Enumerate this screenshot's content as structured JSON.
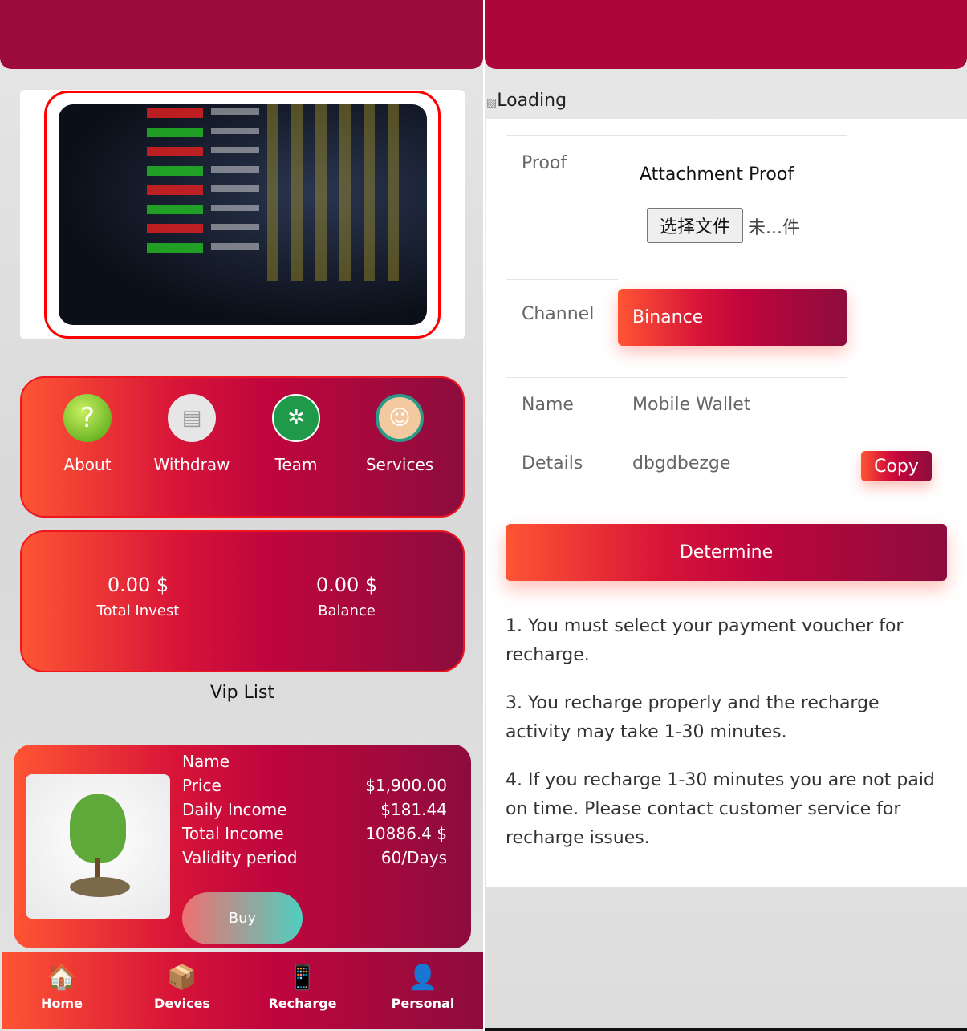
{
  "home": {
    "menu": [
      {
        "label": "About",
        "icon": "question-icon"
      },
      {
        "label": "Withdraw",
        "icon": "atm-icon"
      },
      {
        "label": "Team",
        "icon": "teamwork-icon"
      },
      {
        "label": "Services",
        "icon": "headset-agent-icon"
      }
    ],
    "stats": [
      {
        "value": "0.00 $",
        "label": "Total Invest"
      },
      {
        "value": "0.00 $",
        "label": "Balance"
      }
    ],
    "vip_title": "Vip List",
    "product": {
      "rows": [
        {
          "label": "Name",
          "value": ""
        },
        {
          "label": "Price",
          "value": "$1,900.00"
        },
        {
          "label": "Daily Income",
          "value": "$181.44"
        },
        {
          "label": "Total Income",
          "value": "10886.4 $"
        },
        {
          "label": "Validity period",
          "value": "60/Days"
        }
      ],
      "buy_label": "Buy"
    },
    "nav": [
      {
        "label": "Home",
        "icon": "home-icon"
      },
      {
        "label": "Devices",
        "icon": "devices-box-icon"
      },
      {
        "label": "Recharge",
        "icon": "recharge-phone-icon"
      },
      {
        "label": "Personal",
        "icon": "avatar-icon"
      }
    ]
  },
  "recharge": {
    "loading_alt": "Loading",
    "proof_label": "Proof",
    "attachment_title": "Attachment Proof",
    "file_button": "选择文件",
    "file_status": "未...件",
    "channel_label": "Channel",
    "channel_value": "Binance",
    "name_label": "Name",
    "name_value": "Mobile Wallet",
    "details_label": "Details",
    "details_value": "dbgdbezge",
    "copy_label": "Copy",
    "determine_label": "Determine",
    "notes": [
      "1. You must select your payment voucher for recharge.",
      "3. You recharge properly and the recharge activity may take 1-30 minutes.",
      "4. If you recharge 1-30 minutes you are not paid on time. Please contact customer service for recharge issues."
    ]
  },
  "colors": {
    "header_left": "#9c0b3b",
    "header_right": "#ad063b",
    "accent_start": "#fe5533",
    "accent_end": "#8d0c3d"
  }
}
